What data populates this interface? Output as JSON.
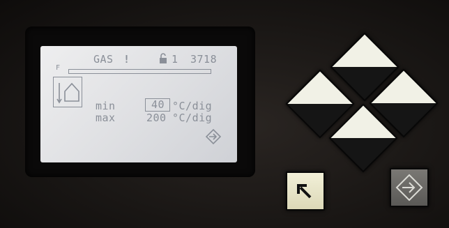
{
  "display": {
    "fuel_label": "GAS",
    "alert_mark": "!",
    "program_number": "1",
    "counter": "3718",
    "bar_left_symbol": "F",
    "progress_fraction": 0.0,
    "rows": [
      {
        "label": "min",
        "value": "40",
        "unit": "°C/dig"
      },
      {
        "label": "max",
        "value": "200",
        "unit": "°C/dig"
      }
    ]
  },
  "icons": {
    "lock": "unlock-icon",
    "house": "house-temperature-icon",
    "next_page": "enter-arrow-icon",
    "nav_up": "arrow-up-key",
    "nav_left": "arrow-left-key",
    "nav_right": "arrow-right-key",
    "nav_down": "arrow-down-key",
    "back": "back-arrow-icon",
    "enter": "enter-icon"
  },
  "colors": {
    "lcd_bg": "#e4e5e8",
    "lcd_ink": "#8a8f98",
    "panel": "#1a1715",
    "key_light": "#f1f1e6",
    "key_dark": "#151515",
    "back_button": "#e8e5c8",
    "enter_button": "#6b6a67"
  }
}
